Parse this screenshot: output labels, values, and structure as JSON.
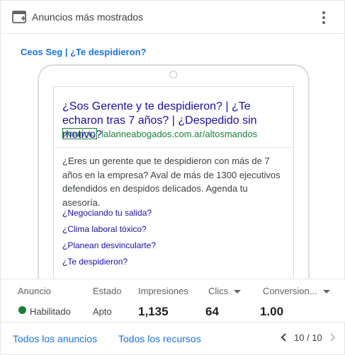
{
  "header": {
    "title": "Anuncios más mostrados"
  },
  "ad_group": "Ceos Seg | ¿Te despidieron?",
  "ad": {
    "headline": "¿Sos Gerente y te despidieron? | ¿Te echaron tras 7 años? | ¿Despedido sin motivo?",
    "badge": "Anuncio",
    "display_url": "lalanneabogados.com.ar/altosmandos",
    "description": "¿Eres un gerente que te despidieron con más de 7 años en la empresa? Aval de más de 1300 ejecutivos defendidos en despidos delicados. Agenda tu asesoría.",
    "sitelinks": [
      "¿Negociando tu salida?",
      "¿Clima laboral tóxico?",
      "¿Planean desvincularte?",
      "¿Te despidieron?"
    ]
  },
  "stats": {
    "labels": {
      "anuncio": "Anuncio",
      "estado": "Estado",
      "impresiones": "Impresiones",
      "clics": "Clics",
      "conversiones": "Conversion..."
    },
    "values": {
      "anuncio": "Habilitado",
      "estado": "Apto",
      "impresiones": "1,135",
      "clics": "64",
      "conversiones": "1.00"
    },
    "status_color": "#188038"
  },
  "footer": {
    "all_ads": "Todos los anuncios",
    "all_assets": "Todos los recursos",
    "page": "10 / 10"
  },
  "colors": {
    "link_blue": "#1a73e8",
    "ad_title": "#1a0dab",
    "ad_green": "#188038"
  },
  "icons": {
    "header": "ad-window-icon",
    "menu": "more-vert-icon",
    "prev": "chevron-left-icon",
    "next": "chevron-right-icon"
  }
}
